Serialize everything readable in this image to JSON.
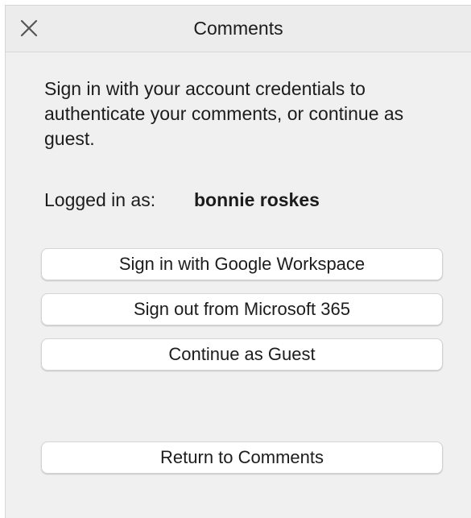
{
  "header": {
    "title": "Comments",
    "close_icon": "close-icon"
  },
  "intro_text": "Sign in with your account credentials to authenticate your comments, or continue as guest.",
  "logged_in": {
    "label": "Logged in as:",
    "user": "bonnie roskes"
  },
  "buttons": {
    "google": "Sign in with Google Workspace",
    "microsoft": "Sign out from Microsoft 365",
    "guest": "Continue as Guest",
    "return": "Return to Comments"
  }
}
